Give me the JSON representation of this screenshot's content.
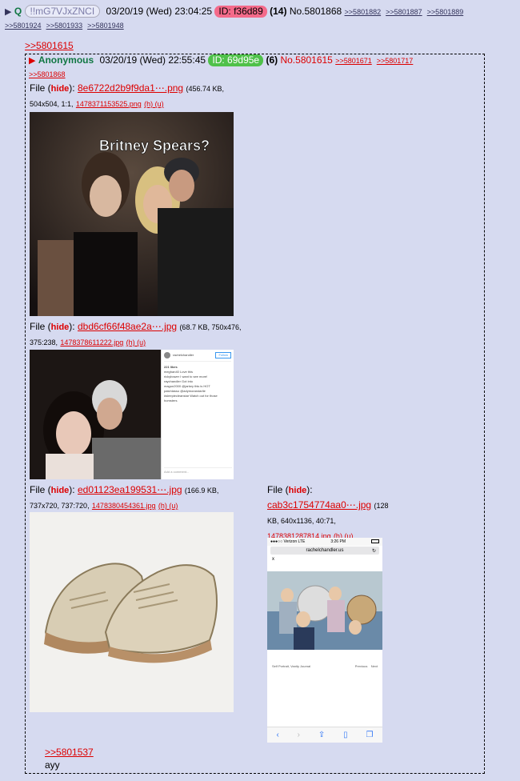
{
  "main_post": {
    "arrow": "▶",
    "name": "Q",
    "tripcode": "!!mG7VJxZNCI",
    "date": "03/20/19 (Wed) 23:04:25",
    "id": "ID: f36d89",
    "count": "(14)",
    "number": "No.5801868",
    "replies_line1": [
      ">>5801882",
      ">>5801887",
      ">>5801889"
    ],
    "replies_line2": [
      ">>5801924",
      ">>5801933",
      ">>5801948"
    ]
  },
  "quote_top": ">>5801615",
  "quoted_post": {
    "arrow": "▶",
    "name": "Anonymous",
    "date": "03/20/19 (Wed) 22:55:45",
    "id": "ID: 69d95e",
    "count": "(6)",
    "number": "No.5801615",
    "replies": [
      ">>5801671",
      ">>5801717",
      ">>5801868"
    ],
    "files": [
      {
        "prefix": "File (",
        "hide": "hide",
        "suffix": "):",
        "name": "8e6722d2b9f9da1⋯.png",
        "meta1": "(456.74 KB,",
        "meta2": "504x504, 1:1,",
        "orig": "1478371153525.png",
        "links": "(h) (u)",
        "overlay_text": "Britney Spears?"
      },
      {
        "prefix": "File (",
        "hide": "hide",
        "suffix": "):",
        "name": "dbd6cf66f48ae2a⋯.jpg",
        "meta1": "(68.7 KB, 750x476,",
        "meta2": "375:238,",
        "orig": "1478378611222.jpg",
        "links": "(h) (u)",
        "insta_user": "rachelchandler",
        "insta_follow": "Follow",
        "insta_likes": "221 likes",
        "insta_comments": [
          "meghan40 Love this",
          "rickybower I want to see more!",
          "raychandler Got into",
          "magon2000 @jarkey this is HOT",
          "patchlasso @adymorandarlie #sleepiecleanstar Watch out for those homsters"
        ],
        "insta_add": "Add a comment..."
      },
      {
        "prefix": "File (",
        "hide": "hide",
        "suffix": "):",
        "name": "ed01123ea199531⋯.jpg",
        "meta1": "(166.9 KB,",
        "meta2": "737x720, 737:720,",
        "orig": "1478380454361.jpg",
        "links": "(h) (u)"
      },
      {
        "prefix": "File (",
        "hide": "hide",
        "suffix": "):",
        "name": "cab3c1754774aa0⋯.jpg",
        "meta1": "(128",
        "meta2": "KB, 640x1136, 40:71,",
        "orig": "1478381287814.jpg",
        "links": "(h) (u)",
        "phone_carrier": "●●●○○ Verizon  LTE",
        "phone_time": "3:26 PM",
        "phone_url": "rachelchandler.us",
        "phone_close": "x",
        "phone_caption": "Self Portrait, Vanity Journal",
        "phone_prev": "Previous",
        "phone_next": "Next"
      }
    ]
  },
  "bottom_quote": ">>5801537",
  "bottom_text": "ayy"
}
